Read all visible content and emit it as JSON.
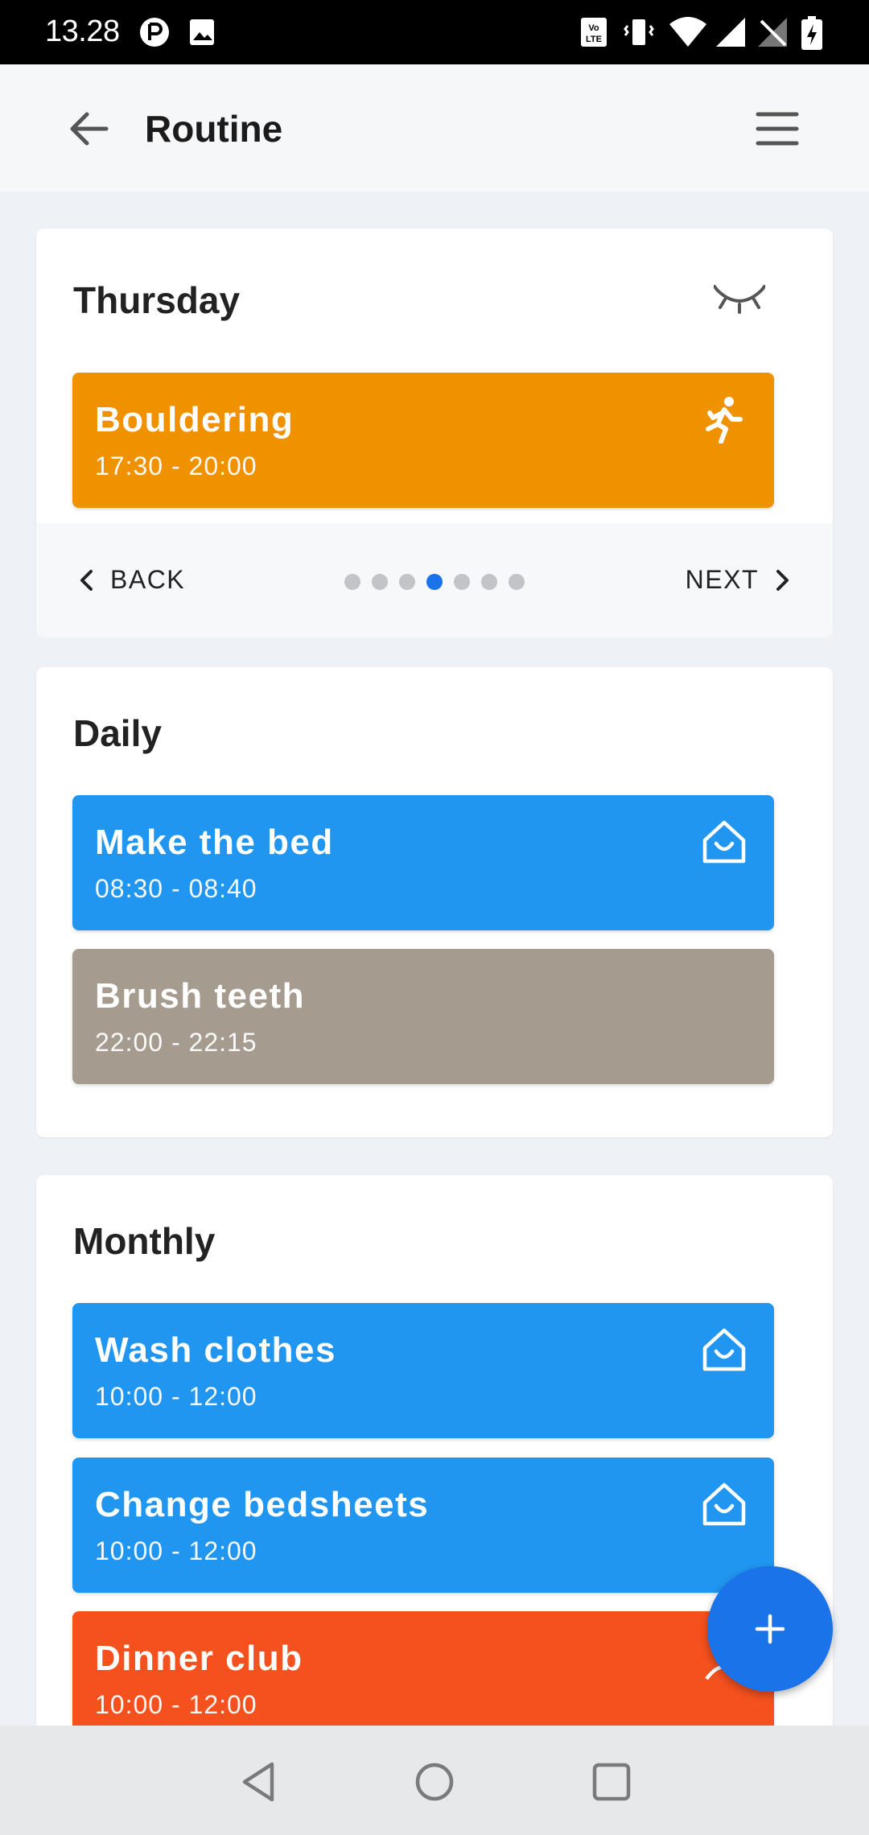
{
  "status_bar": {
    "time": "13.28"
  },
  "app_bar": {
    "title": "Routine"
  },
  "colors": {
    "accent": "#1a73e8",
    "orange": "#f09200",
    "blue": "#2196f0",
    "taupe": "#a69b8f",
    "red_orange": "#f4511e"
  },
  "sections": {
    "thursday": {
      "title": "Thursday",
      "items": [
        {
          "name": "Bouldering",
          "time": "17:30 - 20:00",
          "icon": "running-icon"
        }
      ],
      "pager": {
        "back_label": "BACK",
        "next_label": "NEXT",
        "pages": 7,
        "active_page": 4
      }
    },
    "daily": {
      "title": "Daily",
      "items": [
        {
          "name": "Make the bed",
          "time": "08:30 - 08:40",
          "icon": "home-icon"
        },
        {
          "name": "Brush teeth",
          "time": "22:00 - 22:15",
          "icon": ""
        }
      ]
    },
    "monthly": {
      "title": "Monthly",
      "items": [
        {
          "name": "Wash clothes",
          "time": "10:00 - 12:00",
          "icon": "home-icon"
        },
        {
          "name": "Change bedsheets",
          "time": "10:00 - 12:00",
          "icon": "home-icon"
        },
        {
          "name": "Dinner club",
          "time": "10:00 - 12:00",
          "icon": "person-icon"
        }
      ]
    }
  }
}
